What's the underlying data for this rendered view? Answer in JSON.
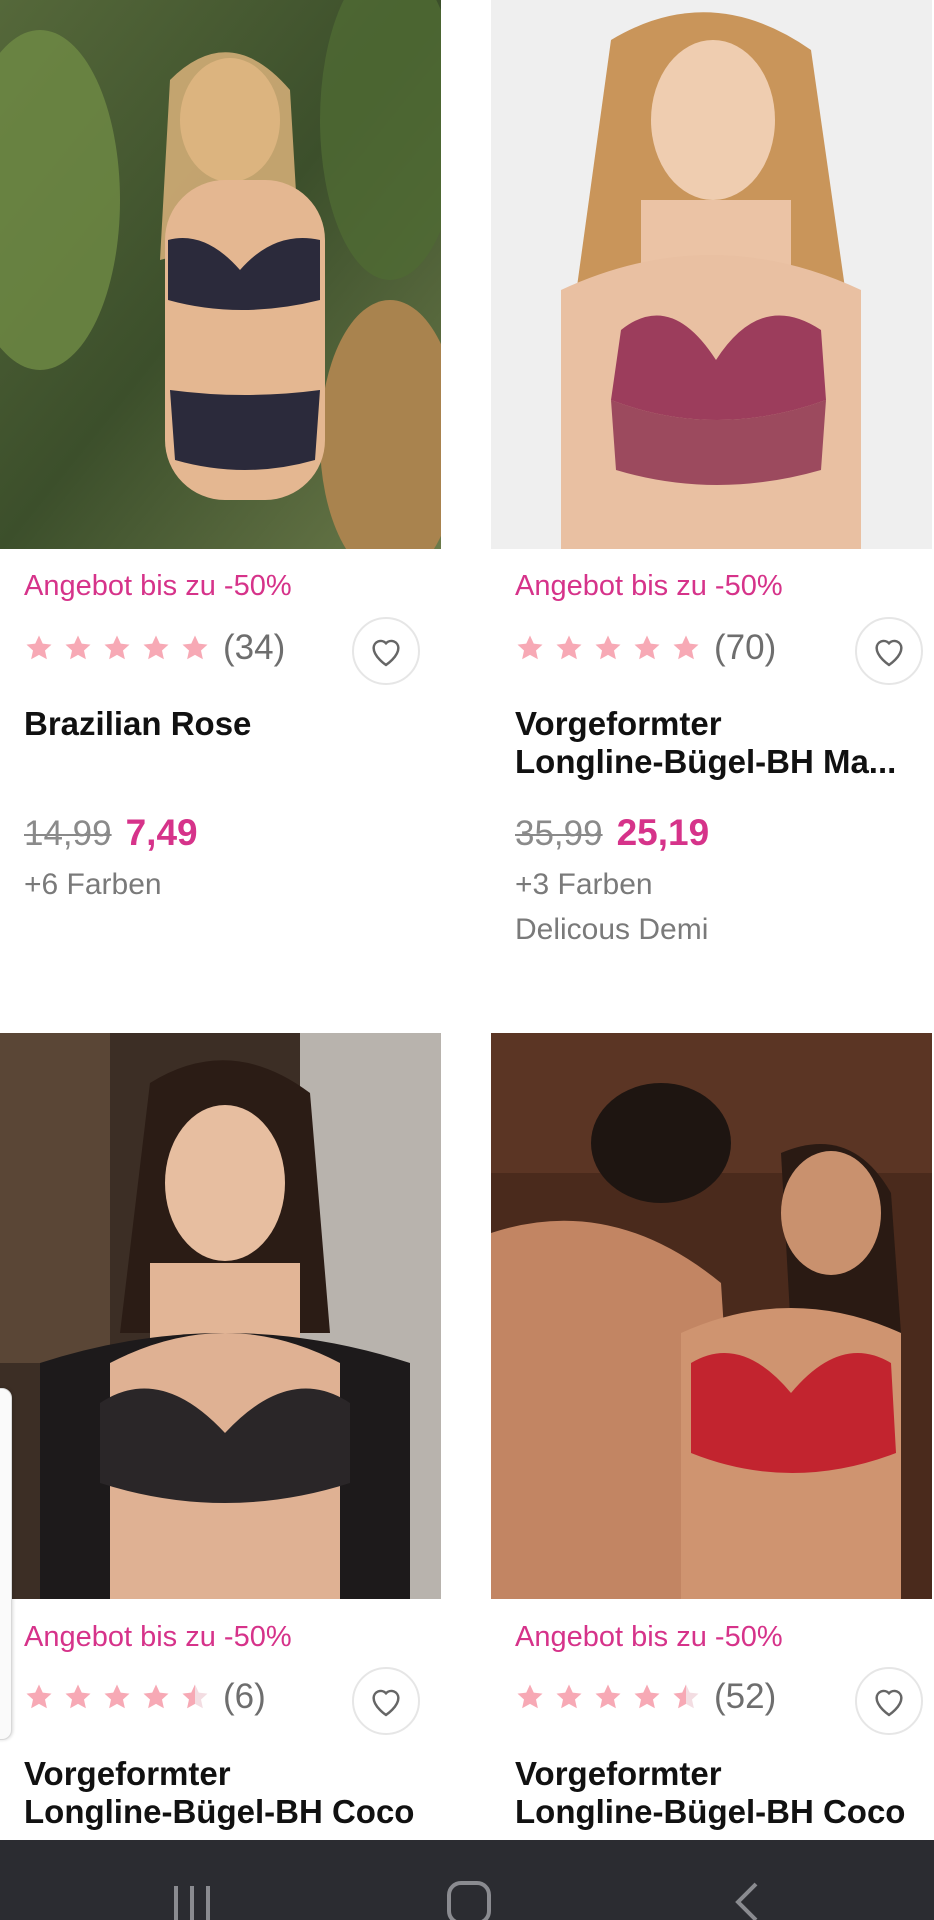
{
  "products": [
    {
      "promo": "Angebot bis zu -50%",
      "rating": 5,
      "reviews": "(34)",
      "title_line1": "Brazilian Rose",
      "title_line2": "",
      "old_price": "14,99",
      "new_price": "7,49",
      "colors": "+6 Farben",
      "collection": ""
    },
    {
      "promo": "Angebot bis zu -50%",
      "rating": 5,
      "reviews": "(70)",
      "title_line1": "Vorgeformter",
      "title_line2": "Longline-Bügel-BH Ma...",
      "old_price": "35,99",
      "new_price": "25,19",
      "colors": "+3 Farben",
      "collection": "Delicous Demi"
    },
    {
      "promo": "Angebot bis zu -50%",
      "rating": 4.5,
      "reviews": "(6)",
      "title_line1": "Vorgeformter",
      "title_line2": "Longline-Bügel-BH Coco",
      "old_price": "",
      "new_price": "",
      "colors": "",
      "collection": ""
    },
    {
      "promo": "Angebot bis zu -50%",
      "rating": 4.5,
      "reviews": "(52)",
      "title_line1": "Vorgeformter",
      "title_line2": "Longline-Bügel-BH Coco",
      "old_price": "",
      "new_price": "",
      "colors": "",
      "collection": ""
    }
  ],
  "icons": {
    "favorite": "heart-icon",
    "star": "star-icon",
    "nav_recent": "recent-apps-icon",
    "nav_home": "home-icon",
    "nav_back": "back-icon"
  },
  "colors": {
    "accent": "#d6338a",
    "star": "#f7a9b5",
    "star_empty": "#f3dde2",
    "navbar": "#2b2c31"
  }
}
